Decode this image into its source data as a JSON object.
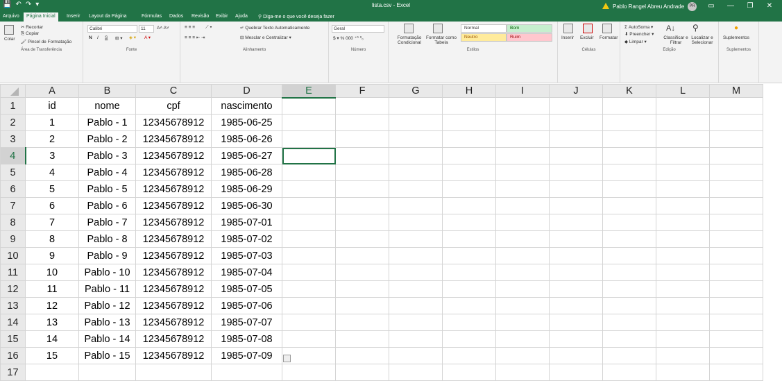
{
  "titlebar": {
    "title": "lista.csv - Excel",
    "user": "Pablo Rangel Abreu Andrade",
    "user_initials": "PR",
    "qat": [
      "💾",
      "↶",
      "↷",
      "▾"
    ]
  },
  "tabs": [
    "Arquivo",
    "Página Inicial",
    "Inserir",
    "Layout da Página",
    "Fórmulas",
    "Dados",
    "Revisão",
    "Exibir",
    "Ajuda",
    "Diga-me o que você deseja fazer"
  ],
  "ribbon": {
    "clipboard": {
      "paste": "Colar",
      "cut": "Recortar",
      "copy": "Copiar",
      "format_painter": "Pincel de Formatação",
      "group": "Área de Transferência"
    },
    "font": {
      "name": "Calibri",
      "size": "11",
      "group": "Fonte",
      "bold": "N",
      "italic": "I",
      "underline": "S"
    },
    "alignment": {
      "wrap": "Quebrar Texto Automaticamente",
      "merge": "Mesclar e Centralizar",
      "group": "Alinhamento"
    },
    "number": {
      "format": "Geral",
      "group": "Número"
    },
    "styles": {
      "conditional": "Formatação Condicional",
      "table": "Formatar como Tabela",
      "normal": "Normal",
      "bom": "Bom",
      "neutro": "Neutro",
      "ruim": "Ruim",
      "group": "Estilos"
    },
    "cells": {
      "insert": "Inserir",
      "delete": "Excluir",
      "format": "Formatar",
      "group": "Células"
    },
    "editing": {
      "autosum": "AutoSoma",
      "fill": "Preencher",
      "clear": "Limpar",
      "sort": "Classificar e Filtrar",
      "find": "Localizar e Selecionar",
      "group": "Edição"
    },
    "addins": {
      "label": "Suplementos",
      "group": "Suplementos"
    }
  },
  "sheet": {
    "columns": [
      "A",
      "B",
      "C",
      "D",
      "E",
      "F",
      "G",
      "H",
      "I",
      "J",
      "K",
      "L",
      "M"
    ],
    "row_numbers": [
      "1",
      "2",
      "3",
      "4",
      "5",
      "6",
      "7",
      "8",
      "9",
      "10",
      "11",
      "12",
      "13",
      "14",
      "15",
      "16",
      "17"
    ],
    "rows": [
      [
        "id",
        "nome",
        "cpf",
        "nascimento"
      ],
      [
        "1",
        "Pablo - 1",
        "12345678912",
        "1985-06-25"
      ],
      [
        "2",
        "Pablo - 2",
        "12345678912",
        "1985-06-26"
      ],
      [
        "3",
        "Pablo - 3",
        "12345678912",
        "1985-06-27"
      ],
      [
        "4",
        "Pablo - 4",
        "12345678912",
        "1985-06-28"
      ],
      [
        "5",
        "Pablo - 5",
        "12345678912",
        "1985-06-29"
      ],
      [
        "6",
        "Pablo - 6",
        "12345678912",
        "1985-06-30"
      ],
      [
        "7",
        "Pablo - 7",
        "12345678912",
        "1985-07-01"
      ],
      [
        "8",
        "Pablo - 8",
        "12345678912",
        "1985-07-02"
      ],
      [
        "9",
        "Pablo - 9",
        "12345678912",
        "1985-07-03"
      ],
      [
        "10",
        "Pablo - 10",
        "12345678912",
        "1985-07-04"
      ],
      [
        "11",
        "Pablo - 11",
        "12345678912",
        "1985-07-05"
      ],
      [
        "12",
        "Pablo - 12",
        "12345678912",
        "1985-07-06"
      ],
      [
        "13",
        "Pablo - 13",
        "12345678912",
        "1985-07-07"
      ],
      [
        "14",
        "Pablo - 14",
        "12345678912",
        "1985-07-08"
      ],
      [
        "15",
        "Pablo - 15",
        "12345678912",
        "1985-07-09"
      ],
      [
        "",
        "",
        "",
        ""
      ]
    ],
    "selected_cell": "E4"
  },
  "colors": {
    "excel_green": "#217346",
    "bom_bg": "#c6efce",
    "neutro_bg": "#ffeb9c",
    "ruim_bg": "#ffc7ce"
  }
}
